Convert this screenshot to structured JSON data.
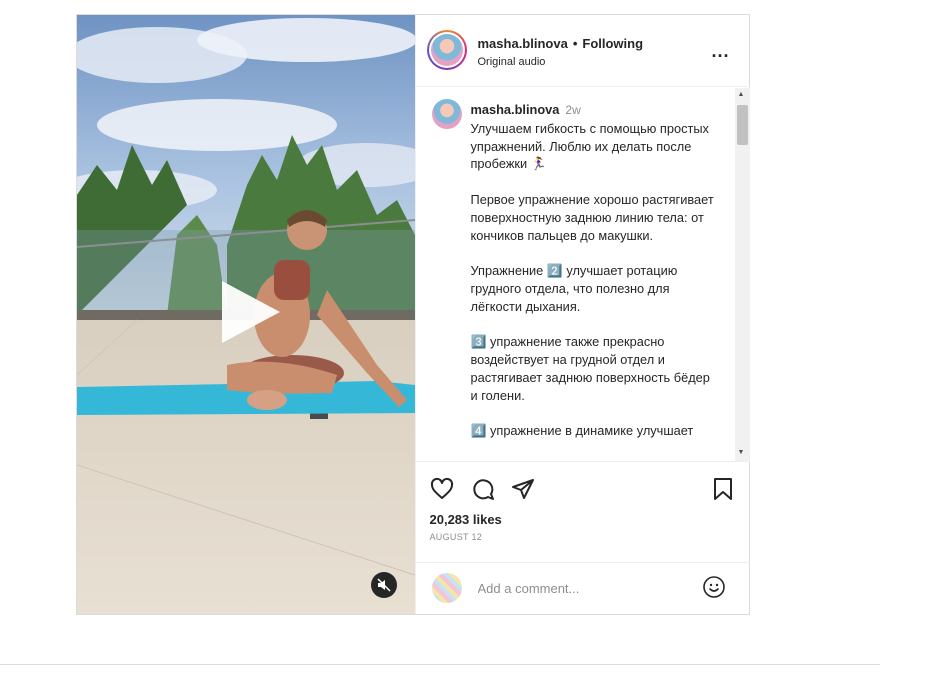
{
  "post": {
    "username": "masha.blinova",
    "separator": "•",
    "follow_label": "Following",
    "audio_label": "Original audio",
    "more_label": "...",
    "caption": {
      "username": "masha.blinova",
      "time": "2w",
      "paragraphs": [
        "Улучшаем гибкость с помощью простых упражнений. Люблю их делать после пробежки 🏃‍♀️",
        "Первое упражнение хорошо растягивает поверхностную заднюю линию тела: от кончиков пальцев до макушки.",
        "Упражнение 2️⃣ улучшает ротацию грудного отдела, что полезно для лёгкости дыхания.",
        "3️⃣ упражнение также прекрасно воздействует на грудной отдел и растягивает заднюю поверхность бёдер и голени.",
        "4️⃣ упражнение в динамике улучшает"
      ]
    },
    "likes": "20,283 likes",
    "date": "AUGUST 12",
    "comment_placeholder": "Add a comment...",
    "icons": [
      "play-icon",
      "mute-icon",
      "heart-icon",
      "comment-icon",
      "share-icon",
      "bookmark-icon",
      "emoji-icon",
      "more-icon"
    ]
  }
}
